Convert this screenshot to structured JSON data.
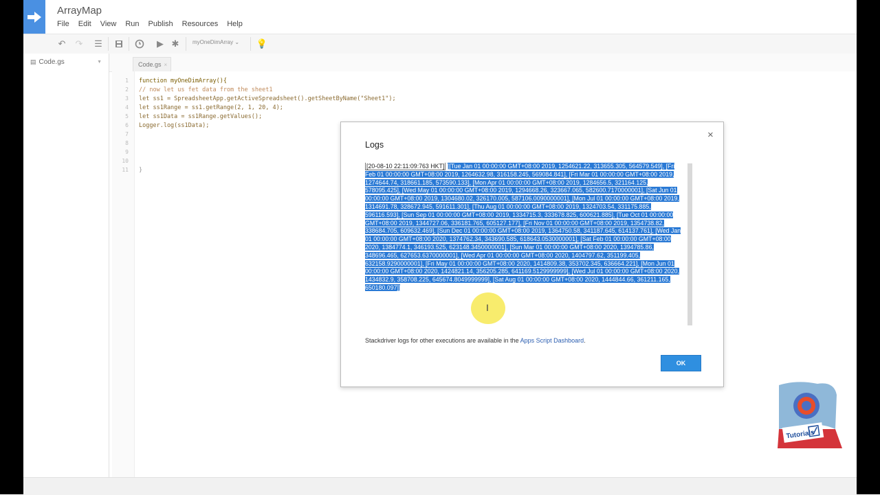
{
  "app": {
    "title": "ArrayMap",
    "menu": [
      "File",
      "Edit",
      "View",
      "Run",
      "Publish",
      "Resources",
      "Help"
    ]
  },
  "toolbar": {
    "function_select": "myOneDimArray"
  },
  "files": [
    {
      "name": "Code.gs"
    }
  ],
  "editor": {
    "tab_label": "Code.gs",
    "line_numbers": [
      "1",
      "2",
      "3",
      "4",
      "5",
      "6",
      "7",
      "8",
      "9",
      "10",
      "11"
    ],
    "lines": [
      {
        "text": "function myOneDimArray(){",
        "color": "#7a5c00"
      },
      {
        "text": "// now let us fet data from the sheet1",
        "color": "#c08a5a"
      },
      {
        "text": "let ss1 = SpreadsheetApp.getActiveSpreadsheet().getSheetByName(\"Sheet1\");",
        "color": "#8a6a30"
      },
      {
        "text": "let ss1Range = ss1.getRange(2, 1, 20, 4);",
        "color": "#8a6a30"
      },
      {
        "text": "let ss1Data = ss1Range.getValues();",
        "color": "#8a6a30"
      },
      {
        "text": "Logger.log(ss1Data);",
        "color": "#8a6a30"
      },
      {
        "text": "",
        "color": "#444"
      },
      {
        "text": "",
        "color": "#444"
      },
      {
        "text": "",
        "color": "#444"
      },
      {
        "text": "",
        "color": "#444"
      },
      {
        "text": "}",
        "color": "#999"
      }
    ]
  },
  "dialog": {
    "title": "Logs",
    "close_symbol": "×",
    "timestamp": "[20-08-10 22:11:09:763 HKT]",
    "log_text": "[[Tue Jan 01 00:00:00 GMT+08:00 2019, 1254621.22, 313655.305, 564579.549], [Fri Feb 01 00:00:00 GMT+08:00 2019, 1264632.98, 316158.245, 569084.841], [Fri Mar 01 00:00:00 GMT+08:00 2019, 1274644.74, 318661.185, 573590.133], [Mon Apr 01 00:00:00 GMT+08:00 2019, 1284656.5, 321164.125, 578095.425], [Wed May 01 00:00:00 GMT+08:00 2019, 1294668.26, 323667.065, 582600.7170000001], [Sat Jun 01 00:00:00 GMT+08:00 2019, 1304680.02, 326170.005, 587106.0090000001], [Mon Jul 01 00:00:00 GMT+08:00 2019, 1314691.78, 328672.945, 591611.301], [Thu Aug 01 00:00:00 GMT+08:00 2019, 1324703.54, 331175.885, 596116.593], [Sun Sep 01 00:00:00 GMT+08:00 2019, 1334715.3, 333678.825, 600621.885], [Tue Oct 01 00:00:00 GMT+08:00 2019, 1344727.06, 336181.765, 605127.177], [Fri Nov 01 00:00:00 GMT+08:00 2019, 1354738.82, 338684.705, 609632.469], [Sun Dec 01 00:00:00 GMT+08:00 2019, 1364750.58, 341187.645, 614137.761], [Wed Jan 01 00:00:00 GMT+08:00 2020, 1374762.34, 343690.585, 618643.0530000001], [Sat Feb 01 00:00:00 GMT+08:00 2020, 1384774.1, 346193.525, 623148.3450000001], [Sun Mar 01 00:00:00 GMT+08:00 2020, 1394785.86, 348696.465, 627653.6370000001], [Wed Apr 01 00:00:00 GMT+08:00 2020, 1404797.62, 351199.405, 632158.9290000001], [Fri May 01 00:00:00 GMT+08:00 2020, 1414809.38, 353702.345, 636664.221], [Mon Jun 01 00:00:00 GMT+08:00 2020, 1424821.14, 356205.285, 641169.5129999999], [Wed Jul 01 00:00:00 GMT+08:00 2020, 1434832.9, 358708.225, 645674.8049999999], [Sat Aug 01 00:00:00 GMT+08:00 2020, 1444844.66, 361211.165, 650180.097]]",
    "footer_prefix": "Stackdriver logs for other executions are available in the ",
    "footer_link": "Apps Script Dashboard",
    "footer_suffix": ".",
    "ok_label": "OK"
  },
  "badge": {
    "text": "Tutorials"
  }
}
